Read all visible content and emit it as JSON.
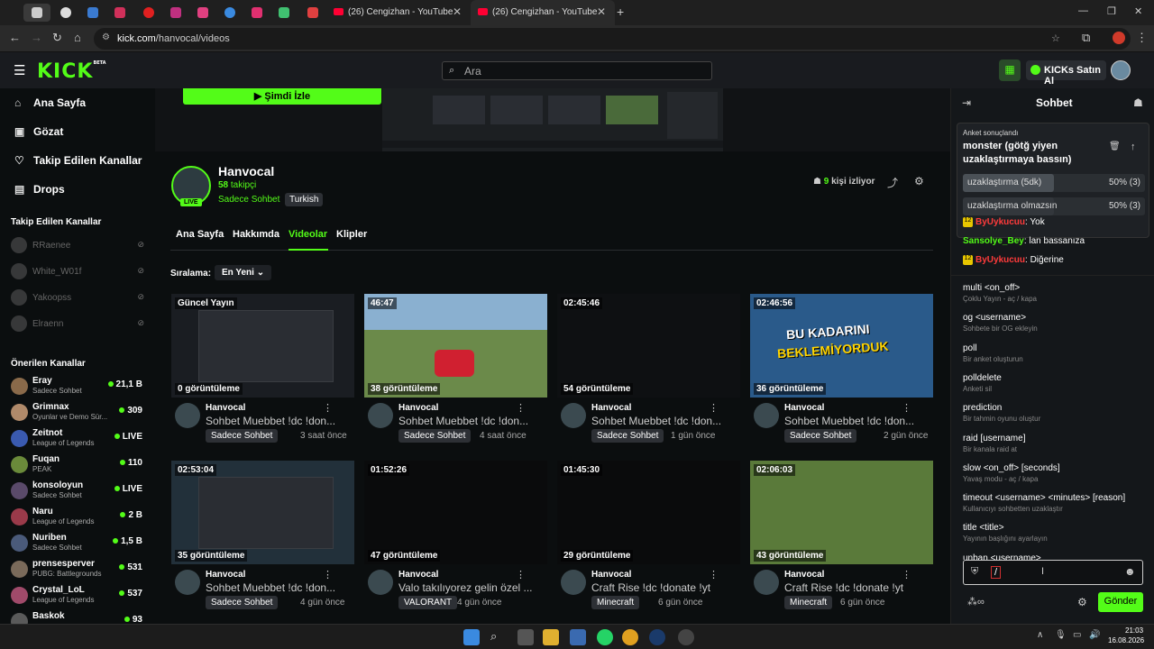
{
  "browser": {
    "tabs": [
      {
        "title": "(26) Cengizhan - YouTube"
      },
      {
        "title": "(26) Cengizhan - YouTube"
      }
    ],
    "new_tab": "+",
    "url_domain": "kick.com",
    "url_path": "/hanvocal/videos",
    "window_controls": [
      "—",
      "❐",
      "✕"
    ]
  },
  "header": {
    "logo": "KICK",
    "logo_badge": "BETA",
    "search_placeholder": "Ara",
    "buy_label": "KICKs Satın Al"
  },
  "sidebar": {
    "nav": [
      {
        "icon": "home-icon",
        "label": "Ana Sayfa"
      },
      {
        "icon": "compass-icon",
        "label": "Gözat"
      },
      {
        "icon": "heart-icon",
        "label": "Takip Edilen Kanallar"
      },
      {
        "icon": "drops-icon",
        "label": "Drops"
      }
    ],
    "followed_heading": "Takip Edilen Kanallar",
    "followed": [
      {
        "name": "RRaenee"
      },
      {
        "name": "White_W01f"
      },
      {
        "name": "Yakoopss"
      },
      {
        "name": "Elraenn"
      }
    ],
    "recommended_heading": "Önerilen Kanallar",
    "recommended": [
      {
        "name": "Eray",
        "category": "Sadece Sohbet",
        "viewers": "21,1 B",
        "color": "#8a6a4a"
      },
      {
        "name": "Grimnax",
        "category": "Oyunlar ve Demo Sür...",
        "viewers": "309",
        "color": "#b08a6a"
      },
      {
        "name": "Zeitnot",
        "category": "League of Legends",
        "viewers": "LIVE",
        "color": "#3a5ab0"
      },
      {
        "name": "Fuqan",
        "category": "PEAK",
        "viewers": "110",
        "color": "#6a8a3a"
      },
      {
        "name": "konsoloyun",
        "category": "Sadece Sohbet",
        "viewers": "LIVE",
        "color": "#5a4a6a"
      },
      {
        "name": "Naru",
        "category": "League of Legends",
        "viewers": "2 B",
        "color": "#9a3a4a"
      },
      {
        "name": "Nuriben",
        "category": "Sadece Sohbet",
        "viewers": "1,5 B",
        "color": "#4a5a7a"
      },
      {
        "name": "prensesperver",
        "category": "PUBG: Battlegrounds",
        "viewers": "531",
        "color": "#7a6a5a"
      },
      {
        "name": "Crystal_LoL",
        "category": "League of Legends",
        "viewers": "537",
        "color": "#a04a6a"
      },
      {
        "name": "Baskok",
        "category": "",
        "viewers": "93",
        "color": "#5a5a5a"
      }
    ]
  },
  "channel": {
    "watch_button": "Şimdi İzle",
    "name": "Hanvocal",
    "followers_count": "58",
    "followers_label": "takipçi",
    "live_badge": "LIVE",
    "category": "Sadece Sohbet",
    "language": "Turkish",
    "watching_count": "9",
    "watching_label": "kişi izliyor",
    "tabs": [
      "Ana Sayfa",
      "Hakkımda",
      "Videolar",
      "Klipler"
    ],
    "active_tab": "Videolar",
    "sort_label": "Sıralama:",
    "sort_value": "En Yeni"
  },
  "videos": [
    {
      "duration": "Güncel Yayın",
      "views": "0 görüntüleme",
      "channel": "Hanvocal",
      "title": "Sohbet Muebbet !dc !don...",
      "tag": "Sadece Sohbet",
      "ago": "3 saat önce",
      "thumb": "#1a1d22"
    },
    {
      "duration": "46:47",
      "views": "38 görüntüleme",
      "channel": "Hanvocal",
      "title": "Sohbet Muebbet !dc !don...",
      "tag": "Sadece Sohbet",
      "ago": "4 saat önce",
      "thumb": "#6b8a4a"
    },
    {
      "duration": "02:45:46",
      "views": "54 görüntüleme",
      "channel": "Hanvocal",
      "title": "Sohbet Muebbet !dc !don...",
      "tag": "Sadece Sohbet",
      "ago": "1 gün önce",
      "thumb": "#0e1012"
    },
    {
      "duration": "02:46:56",
      "views": "36 görüntüleme",
      "channel": "Hanvocal",
      "title": "Sohbet Muebbet !dc !don...",
      "tag": "Sadece Sohbet",
      "ago": "2 gün önce",
      "thumb": "#2a5a8a"
    },
    {
      "duration": "02:53:04",
      "views": "35 görüntüleme",
      "channel": "Hanvocal",
      "title": "Sohbet Muebbet !dc !don...",
      "tag": "Sadece Sohbet",
      "ago": "4 gün önce",
      "thumb": "#22303a"
    },
    {
      "duration": "01:52:26",
      "views": "47 görüntüleme",
      "channel": "Hanvocal",
      "title": "Valo takılıyorez gelin özel ...",
      "tag": "VALORANT",
      "ago": "4 gün önce",
      "thumb": "#0a0b0c"
    },
    {
      "duration": "01:45:30",
      "views": "29 görüntüleme",
      "channel": "Hanvocal",
      "title": "Craft Rise !dc !donate !yt",
      "tag": "Minecraft",
      "ago": "6 gün önce",
      "thumb": "#0a0b0c"
    },
    {
      "duration": "02:06:03",
      "views": "43 görüntüleme",
      "channel": "Hanvocal",
      "title": "Craft Rise !dc !donate !yt",
      "tag": "Minecraft",
      "ago": "6 gün önce",
      "thumb": "#5a7a3a"
    }
  ],
  "thumb4_text": {
    "line1": "BU KADARINI",
    "line2": "BEKLEMİYORDUK"
  },
  "chat": {
    "title": "Sohbet",
    "poll": {
      "status": "Anket sonuçlandı",
      "question": "monster (götğ yiyen uzaklaştırmaya bassın)",
      "options": [
        {
          "label": "uzaklaştırma (5dk)",
          "pct": "50% (3)",
          "fraction": 0.5
        },
        {
          "label": "uzaklaştırma olmazsın",
          "pct": "50% (3)",
          "fraction": 0.5
        }
      ]
    },
    "messages": [
      {
        "badge": "12",
        "user": "ByUykucuu",
        "color": "#ff3b3b",
        "text": ": Yok"
      },
      {
        "badge": "",
        "user": "Sansolye_Bey",
        "color": "#53fc18",
        "text": ": lan bassanıza"
      },
      {
        "badge": "12",
        "user": "ByUykucuu",
        "color": "#ff3b3b",
        "text": ": Diğerine"
      }
    ],
    "commands": [
      {
        "name": "multi <on_off>",
        "desc": "Çoklu Yayın - aç / kapa"
      },
      {
        "name": "og <username>",
        "desc": "Sohbete bir OG ekleyin"
      },
      {
        "name": "poll",
        "desc": "Bir anket oluşturun"
      },
      {
        "name": "polldelete",
        "desc": "Anketi sil"
      },
      {
        "name": "prediction",
        "desc": "Bir tahmin oyunu oluştur"
      },
      {
        "name": "raid [username]",
        "desc": "Bir kanala raid at"
      },
      {
        "name": "slow <on_off> [seconds]",
        "desc": "Yavaş modu - aç / kapa"
      },
      {
        "name": "timeout <username> <minutes> [reason]",
        "desc": "Kullanıcıyı sohbetten uzaklaştır"
      },
      {
        "name": "title <title>",
        "desc": "Yayının başlığını ayarlayın"
      },
      {
        "name": "unban <username>",
        "desc": ""
      }
    ],
    "input_value": "/",
    "send_label": "Gönder"
  },
  "taskbar": {
    "time": "21:03",
    "date": "16.08.2026"
  }
}
